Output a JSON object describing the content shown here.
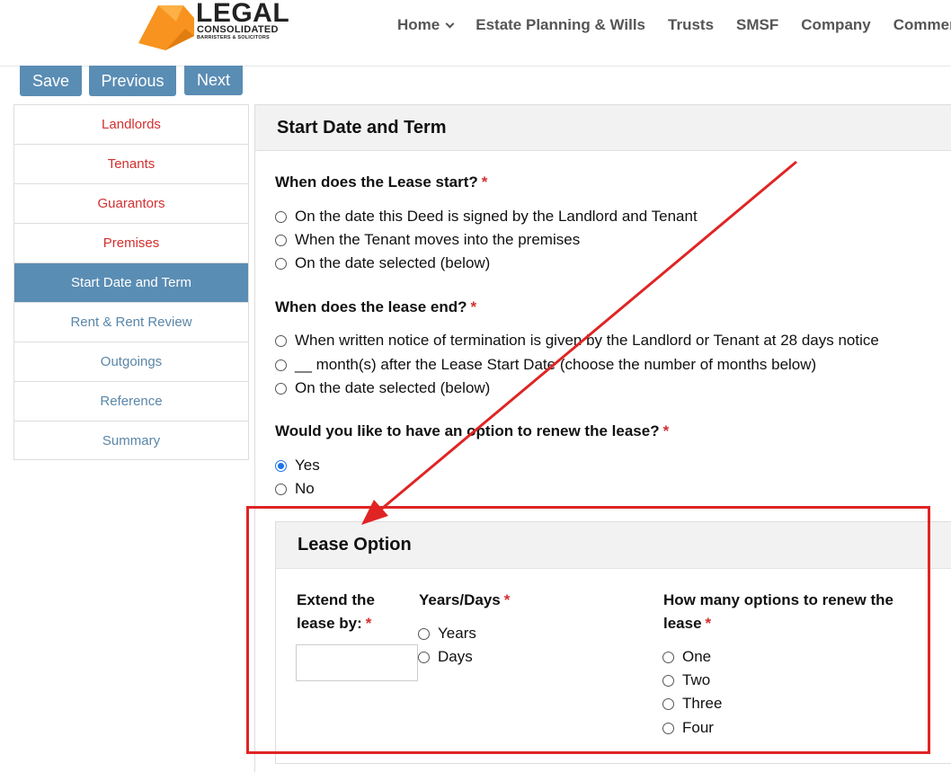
{
  "header": {
    "logo_main": "LEGAL",
    "logo_sub": "CONSOLIDATED",
    "logo_sub2": "BARRISTERS & SOLICITORS",
    "nav": [
      {
        "label": "Home",
        "has_dropdown": true
      },
      {
        "label": "Estate Planning & Wills",
        "has_dropdown": false
      },
      {
        "label": "Trusts",
        "has_dropdown": false
      },
      {
        "label": "SMSF",
        "has_dropdown": false
      },
      {
        "label": "Company",
        "has_dropdown": false
      },
      {
        "label": "Commercial",
        "has_dropdown": false
      }
    ]
  },
  "toolbar": {
    "save": "Save",
    "previous": "Previous",
    "next": "Next"
  },
  "sidebar": {
    "items": [
      {
        "label": "Landlords",
        "state": "error"
      },
      {
        "label": "Tenants",
        "state": "error"
      },
      {
        "label": "Guarantors",
        "state": "error"
      },
      {
        "label": "Premises",
        "state": "error"
      },
      {
        "label": "Start Date and Term",
        "state": "active"
      },
      {
        "label": "Rent & Rent Review",
        "state": "default"
      },
      {
        "label": "Outgoings",
        "state": "default"
      },
      {
        "label": "Reference",
        "state": "default"
      },
      {
        "label": "Summary",
        "state": "default"
      }
    ]
  },
  "main": {
    "title": "Start Date and Term",
    "q_start": {
      "label": "When does the Lease start?",
      "required": "*",
      "options": [
        "On the date this Deed is signed by the Landlord and Tenant",
        "When the Tenant moves into the premises",
        "On the date selected (below)"
      ]
    },
    "q_end": {
      "label": "When does the lease end?",
      "required": "*",
      "options": [
        "When written notice of termination is given by the Landlord or Tenant at 28 days notice",
        "__ month(s) after the Lease Start Date (choose the number of months below)",
        "On the date selected (below)"
      ]
    },
    "q_renew": {
      "label": "Would you like to have an option to renew the lease?",
      "required": "*",
      "options": [
        "Yes",
        "No"
      ],
      "selected": "Yes"
    }
  },
  "lease_option": {
    "title": "Lease Option",
    "extend_label_1": "Extend the",
    "extend_label_2": "lease by:",
    "extend_value": "",
    "years_days_label": "Years/Days",
    "years_days_options": [
      "Years",
      "Days"
    ],
    "count_label_1": "How many options to renew the",
    "count_label_2": "lease",
    "count_options": [
      "One",
      "Two",
      "Three",
      "Four"
    ],
    "required": "*"
  },
  "colors": {
    "accent": "#5a8db4",
    "error": "#d32f2f",
    "annotation": "#e02424",
    "logo_orange": "#f7931e"
  }
}
